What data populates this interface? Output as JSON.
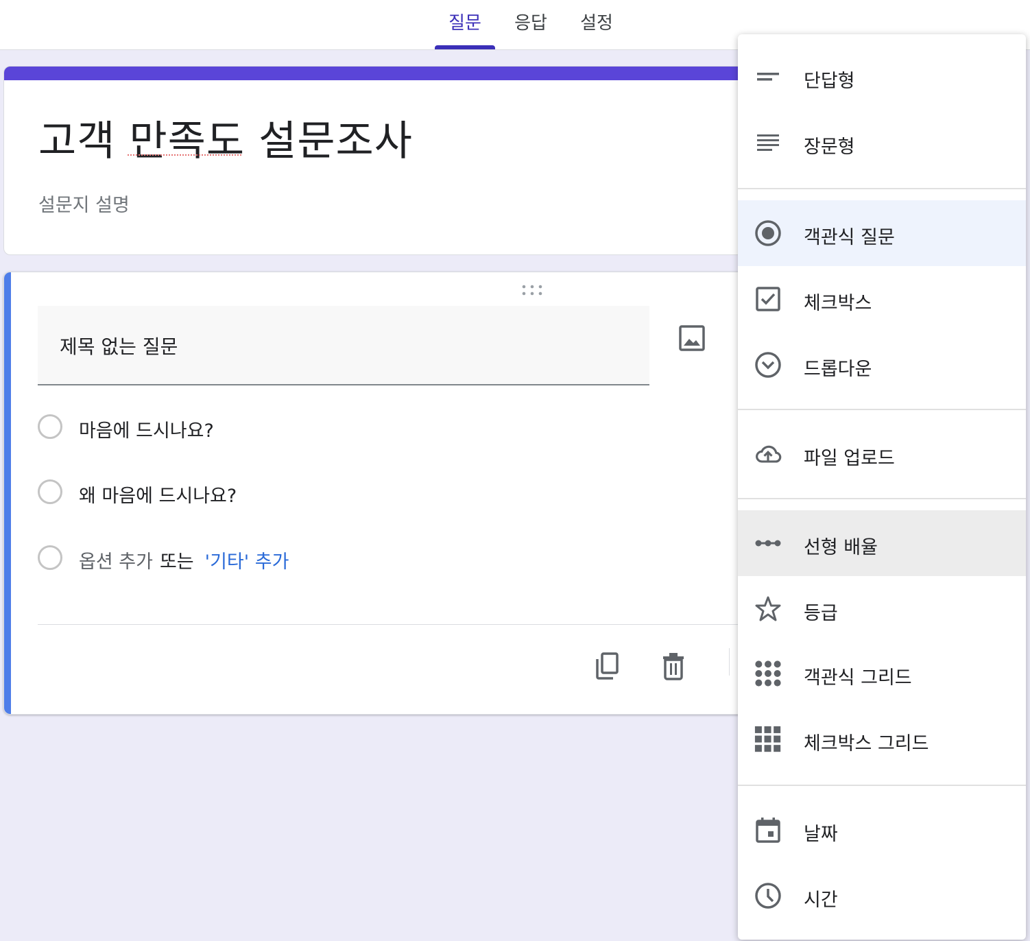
{
  "tabs": {
    "questions": "질문",
    "responses": "응답",
    "settings": "설정"
  },
  "form": {
    "title": "고객 만족도 설문조사",
    "description": "설문지 설명"
  },
  "question": {
    "title": "제목 없는 질문",
    "options": [
      "마음에 드시나요?",
      "왜 마음에 드시나요?"
    ],
    "add_option": "옵션 추가",
    "or": "또는",
    "add_other": "'기타' 추가"
  },
  "menu": {
    "items": [
      {
        "label": "단답형",
        "icon": "short-answer-icon"
      },
      {
        "label": "장문형",
        "icon": "paragraph-icon"
      },
      {
        "label": "객관식 질문",
        "icon": "radio-button-icon"
      },
      {
        "label": "체크박스",
        "icon": "checkbox-icon"
      },
      {
        "label": "드롭다운",
        "icon": "dropdown-icon"
      },
      {
        "label": "파일 업로드",
        "icon": "cloud-upload-icon"
      },
      {
        "label": "선형 배율",
        "icon": "linear-scale-icon"
      },
      {
        "label": "등급",
        "icon": "star-icon"
      },
      {
        "label": "객관식 그리드",
        "icon": "grid-dots-icon"
      },
      {
        "label": "체크박스 그리드",
        "icon": "grid-squares-icon"
      },
      {
        "label": "날짜",
        "icon": "calendar-icon"
      },
      {
        "label": "시간",
        "icon": "clock-icon"
      }
    ],
    "selected": "객관식 질문",
    "hovered": "선형 배율"
  },
  "colors": {
    "accent": "#5a45d8",
    "tab_active": "#3b2fb8",
    "question_accent": "#4e7de9",
    "link": "#2a6ad8",
    "background": "#ecebf8"
  }
}
